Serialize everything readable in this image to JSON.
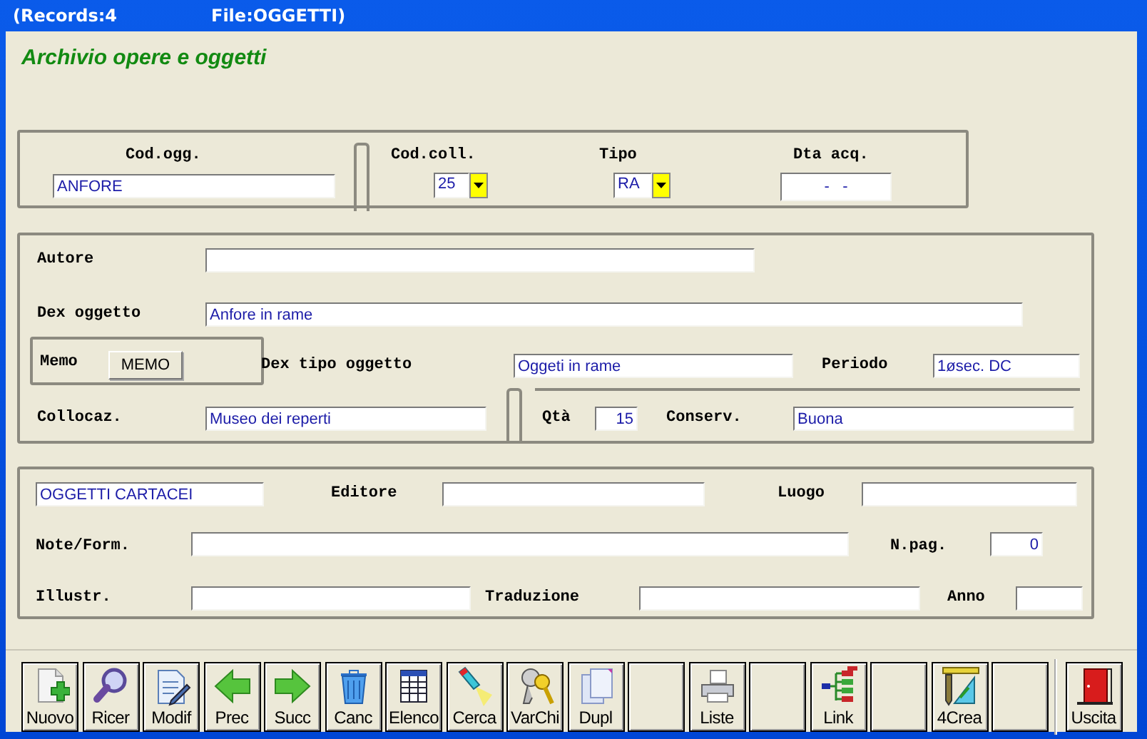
{
  "window": {
    "title_parts": [
      "(Records:4",
      "File:OGGETTI)"
    ]
  },
  "heading": "Archivio opere e oggetti",
  "panel_1": [
    {
      "label": "Cod.ogg.",
      "value": "ANFORE",
      "kind": "text"
    },
    {
      "label": "Cod.coll.",
      "value": "25",
      "kind": "combo"
    },
    {
      "label": "Tipo",
      "value": "RA",
      "kind": "combo"
    },
    {
      "label": "Dta acq.",
      "value": "-   -",
      "kind": "date"
    }
  ],
  "panel_2": [
    {
      "label": "Autore",
      "kind": "text"
    },
    {
      "label": "Dex oggetto",
      "value": "Anfore in rame",
      "kind": "text"
    },
    {
      "label": "Memo",
      "button": "MEMO",
      "kind": "memo"
    },
    {
      "label": "Dex tipo oggetto",
      "value": "Oggeti in rame",
      "kind": "text"
    },
    {
      "label": "Periodo",
      "value": "1øsec. DC",
      "kind": "text"
    },
    {
      "label": "Collocaz.",
      "value": "Museo dei reperti",
      "kind": "text"
    },
    {
      "label": "Qtà",
      "value": "15",
      "kind": "number"
    },
    {
      "label": "Conserv.",
      "value": "Buona",
      "kind": "text"
    }
  ],
  "panel_3": [
    {
      "value": "OGGETTI CARTACEI",
      "kind": "text"
    },
    {
      "label": "Editore",
      "kind": "text"
    },
    {
      "label": "Luogo",
      "kind": "text"
    },
    {
      "label": "Note/Form.",
      "kind": "text"
    },
    {
      "label": "N.pag.",
      "value": "0",
      "kind": "number"
    },
    {
      "label": "Illustr.",
      "kind": "text"
    },
    {
      "label": "Traduzione",
      "kind": "text"
    },
    {
      "label": "Anno",
      "kind": "text"
    }
  ],
  "toolbar": [
    {
      "kind": "tool",
      "label": "Nuovo"
    },
    {
      "kind": "tool",
      "label": "Ricer"
    },
    {
      "kind": "tool",
      "label": "Modif"
    },
    {
      "kind": "tool",
      "label": "Prec"
    },
    {
      "kind": "tool",
      "label": "Succ"
    },
    {
      "kind": "tool",
      "label": "Canc"
    },
    {
      "kind": "tool",
      "label": "Elenco"
    },
    {
      "kind": "tool",
      "label": "Cerca"
    },
    {
      "kind": "tool",
      "label": "VarChi"
    },
    {
      "kind": "tool",
      "label": "Dupl"
    },
    {
      "kind": "blank"
    },
    {
      "kind": "tool",
      "label": "Liste"
    },
    {
      "kind": "blank"
    },
    {
      "kind": "tool",
      "label": "Link"
    },
    {
      "kind": "blank"
    },
    {
      "kind": "tool",
      "label": "4Crea"
    },
    {
      "kind": "blank"
    },
    {
      "kind": "exit",
      "label": "Uscita"
    }
  ]
}
